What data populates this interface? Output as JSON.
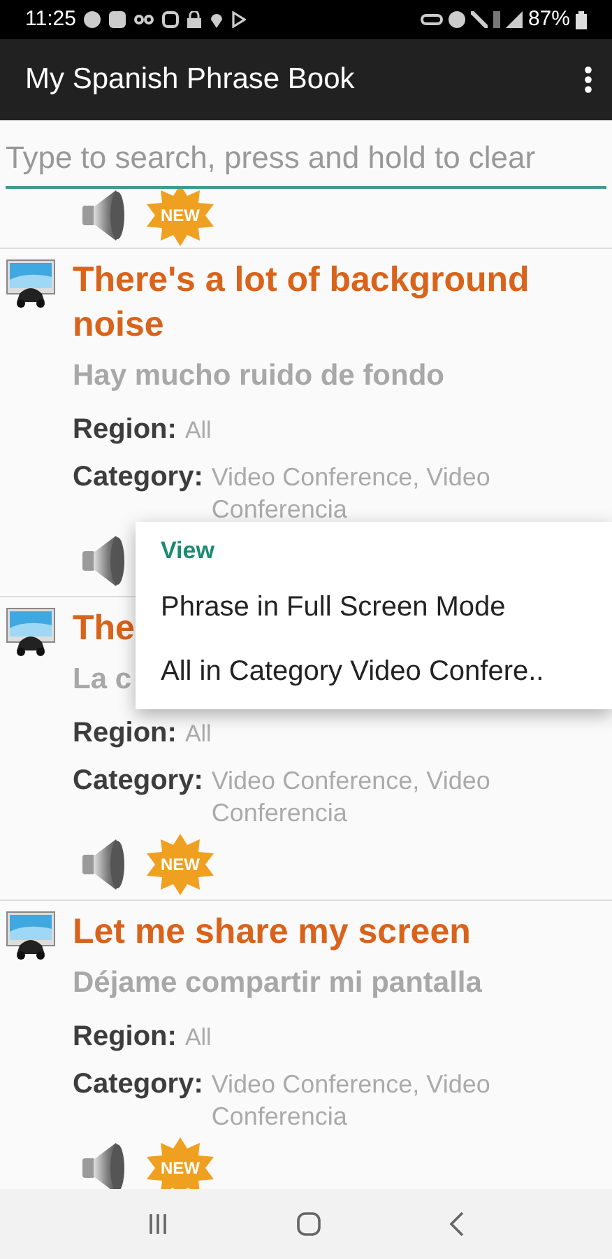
{
  "status_bar": {
    "time": "11:25",
    "battery": "87%"
  },
  "app_bar": {
    "title": "My Spanish Phrase Book"
  },
  "search": {
    "placeholder": "Type to search, press and hold to clear"
  },
  "top_row": {
    "badge": "NEW"
  },
  "phrases": [
    {
      "english": "There's a lot of background noise",
      "spanish": "Hay mucho ruido de fondo",
      "region_label": "Region:",
      "region": "All",
      "category_label": "Category:",
      "category": "Video Conference, Video Conferencia"
    },
    {
      "english": "The",
      "spanish": "La c",
      "region_label": "Region:",
      "region": "All",
      "category_label": "Category:",
      "category": "Video Conference, Video Conferencia",
      "badge": "NEW"
    },
    {
      "english": "Let me share my screen",
      "spanish": "Déjame compartir mi pantalla",
      "region_label": "Region:",
      "region": "All",
      "category_label": "Category:",
      "category": "Video Conference, Video Conferencia",
      "badge": "NEW"
    }
  ],
  "menu": {
    "header": "View",
    "items": [
      "Phrase in Full Screen Mode",
      "All in Category Video Confere.."
    ]
  }
}
